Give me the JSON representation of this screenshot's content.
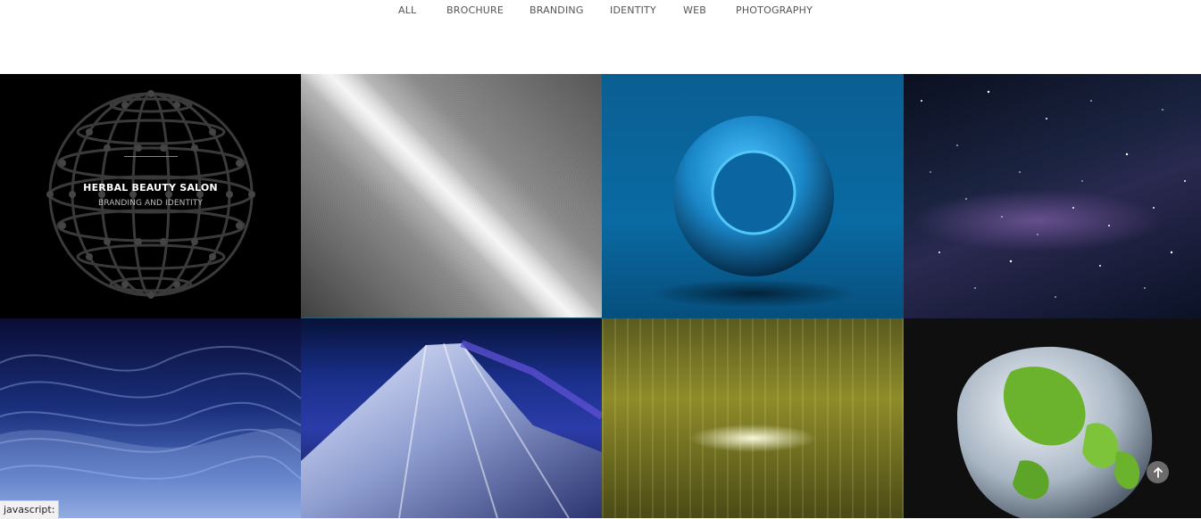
{
  "filters": {
    "items": [
      {
        "label": "ALL"
      },
      {
        "label": "BROCHURE"
      },
      {
        "label": "BRANDING"
      },
      {
        "label": "IDENTITY"
      },
      {
        "label": "WEB"
      },
      {
        "label": "PHOTOGRAPHY"
      }
    ]
  },
  "portfolio": {
    "hovered_item": {
      "title": "HERBAL BEAUTY SALON",
      "subtitle": "BRANDING AND IDENTITY"
    }
  },
  "status_bar": {
    "text": "javascript:"
  },
  "icons": {
    "scroll_top": "arrow-up-icon"
  },
  "colors": {
    "accent": "#1fa9d6",
    "scroll_button": "#6b6b6b"
  }
}
